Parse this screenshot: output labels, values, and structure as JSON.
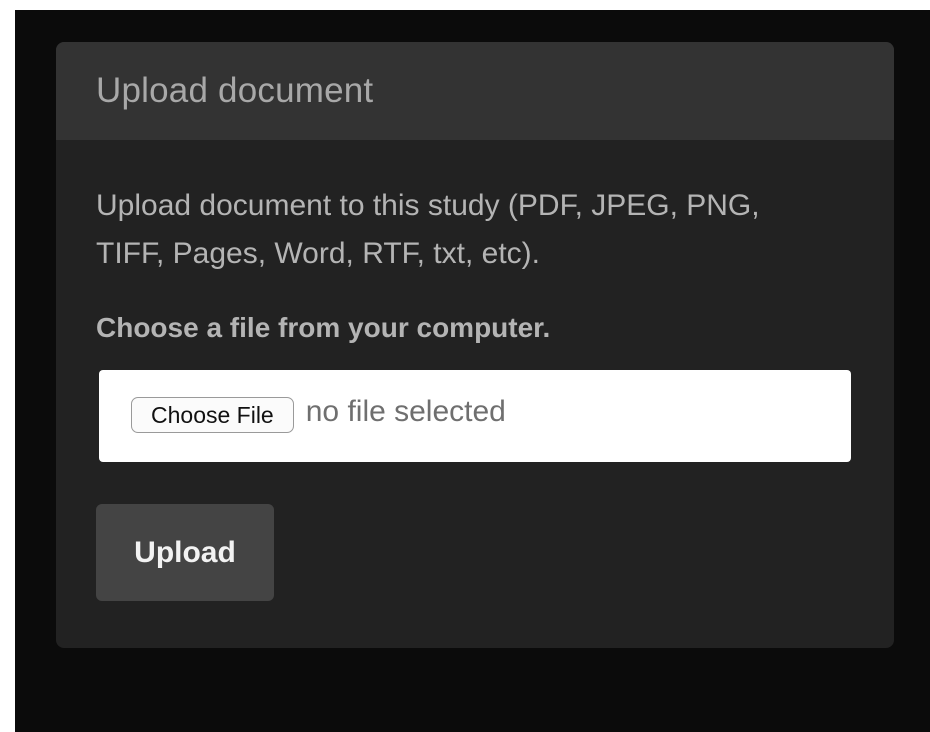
{
  "dialog": {
    "title": "Upload document",
    "description": "Upload document to this study (PDF, JPEG, PNG, TIFF, Pages, Word, RTF, txt, etc).",
    "prompt": "Choose a file from your computer.",
    "file_input": {
      "button_label": "Choose File",
      "status_text": "no file selected"
    },
    "upload_button_label": "Upload"
  },
  "colors": {
    "backdrop": "#0b0b0b",
    "panel": "#222222",
    "header": "#333333",
    "upload_button": "#444444"
  }
}
